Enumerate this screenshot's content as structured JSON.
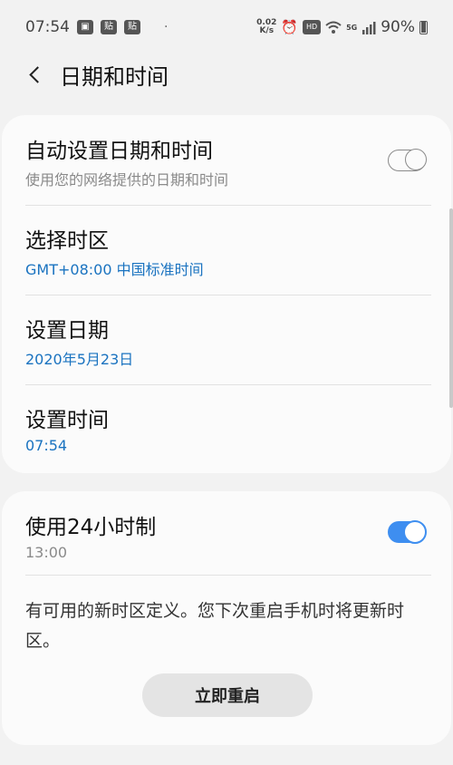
{
  "status_bar": {
    "time": "07:54",
    "notif1": "🖼",
    "notif2": "贴",
    "notif3": "贴",
    "dot": "·",
    "speed_top": "0.02",
    "speed_bottom": "K/s",
    "alarm_icon": "⏰",
    "hd": "HD",
    "wifi_icon": "wifi",
    "fiveg": "5G",
    "signal_icon": "▂▄▆",
    "battery_percent": "90%"
  },
  "header": {
    "back_icon": "chevron-left",
    "title": "日期和时间"
  },
  "card1": {
    "rows": [
      {
        "title": "自动设置日期和时间",
        "subtitle": "使用您的网络提供的日期和时间",
        "toggle": "off"
      },
      {
        "title": "选择时区",
        "subtitle": "GMT+08:00 中国标准时间"
      },
      {
        "title": "设置日期",
        "subtitle": "2020年5月23日"
      },
      {
        "title": "设置时间",
        "subtitle": "07:54"
      }
    ]
  },
  "card2": {
    "row": {
      "title": "使用24小时制",
      "subtitle": "13:00",
      "toggle": "on"
    },
    "notice": "有可用的新时区定义。您下次重启手机时将更新时区。",
    "restart_button": "立即重启"
  },
  "colors": {
    "accent": "#3e8ef0",
    "link_blue": "#1a73c0",
    "background": "#f2f2f2",
    "card": "#fbfbfb"
  }
}
